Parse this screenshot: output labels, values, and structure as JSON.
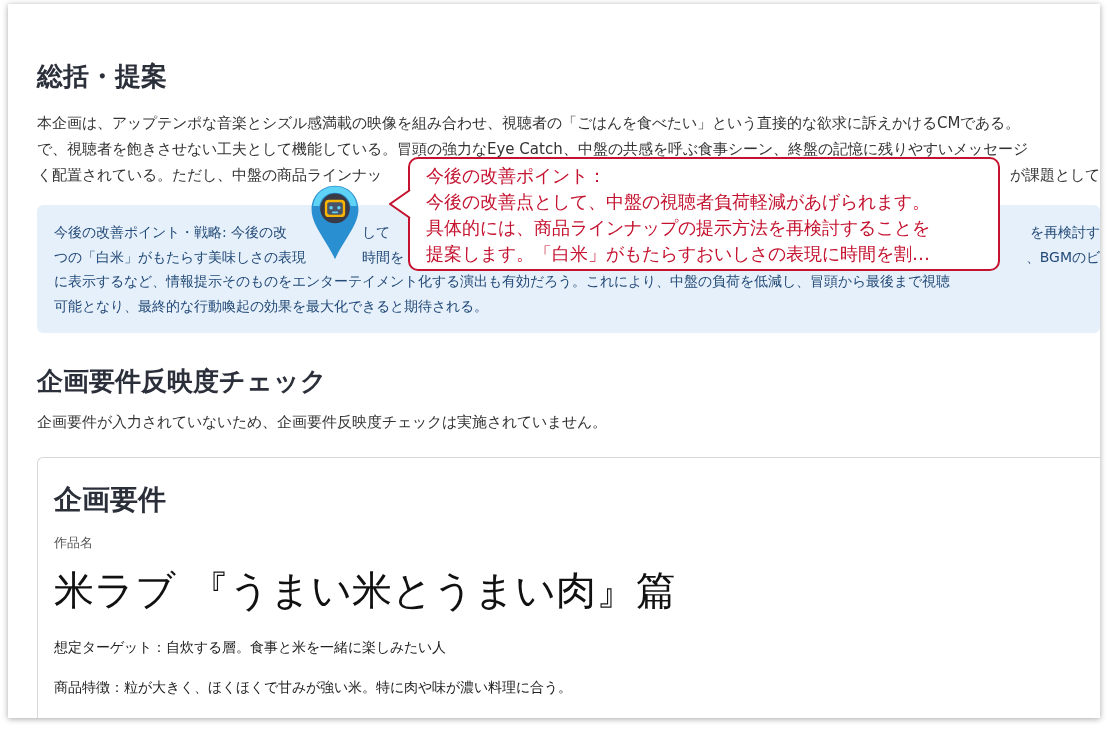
{
  "summary": {
    "heading": "総括・提案",
    "paragraph_lines": [
      [
        "本企画は、アップテンポな音楽とシズル感満載の映像を組み合わせ、視聴者の「ごはんを食べたい」という直接的な欲求に訴えかけるCMである。"
      ],
      [
        "で、視聴者を飽きさせない工夫として機能している。冒頭の強力なEye Catch、中盤の共感を呼ぶ食事シーン、終盤の記憶に残りやすいメッセージ"
      ],
      [
        "く配置されている。ただし、中盤の商品ラインナッ",
        "が課題として"
      ]
    ],
    "strategy_lines": [
      [
        "今後の改善ポイント・戦略: 今後の改",
        "して",
        "を再検討す"
      ],
      [
        "つの「白米」がもたらす美味しさの表現",
        "時間を",
        "、BGMのビ"
      ],
      [
        "に表示するなど、情報提示そのものをエンターテイメント化する演出も有効だろう。これにより、中盤の負荷を低減し、冒頭から最後まで視聴"
      ],
      [
        "可能となり、最終的な行動喚起の効果を最大化できると期待される。"
      ]
    ]
  },
  "requirements_check": {
    "heading": "企画要件反映度チェック",
    "note": "企画要件が入力されていないため、企画要件反映度チェックは実施されていません。"
  },
  "requirements_card": {
    "heading": "企画要件",
    "work_label": "作品名",
    "work_title": "米ラブ 『うまい米とうまい肉』篇",
    "details": [
      "想定ターゲット：自炊する層。食事と米を一緒に楽しみたい人",
      "商品特徴：粒が大きく、ほくほくで甘みが強い米。特に肉や味が濃い料理に合う。"
    ]
  },
  "callout": {
    "lines": [
      "今後の改善ポイント：",
      "今後の改善点として、中盤の視聴者負荷軽減があげられます。",
      "具体的には、商品ラインナップの提示方法を再検討することを",
      "提案します。「白米」がもたらすおいしさの表現に時間を割…"
    ]
  }
}
